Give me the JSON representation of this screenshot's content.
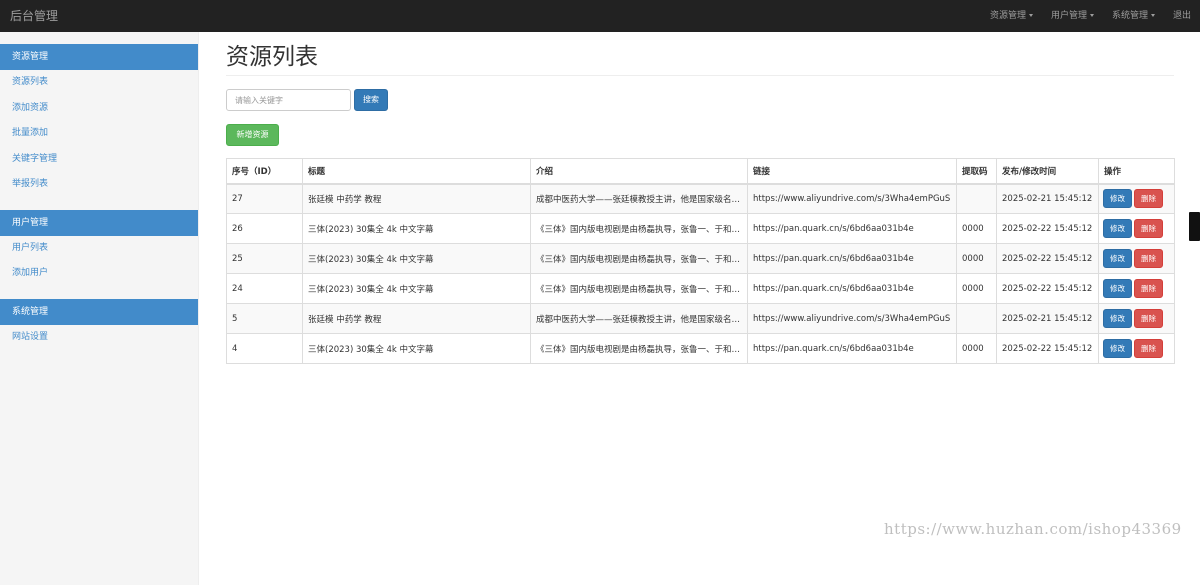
{
  "navbar": {
    "brand": "后台管理",
    "items": [
      {
        "label": "资源管理",
        "dropdown": true
      },
      {
        "label": "用户管理",
        "dropdown": true
      },
      {
        "label": "系统管理",
        "dropdown": true
      },
      {
        "label": "退出",
        "dropdown": false
      }
    ]
  },
  "sidebar": {
    "groups": [
      {
        "title": "资源管理",
        "items": [
          "资源列表",
          "添加资源",
          "批量添加",
          "关键字管理",
          "举报列表"
        ]
      },
      {
        "title": "用户管理",
        "items": [
          "用户列表",
          "添加用户"
        ]
      },
      {
        "title": "系统管理",
        "items": [
          "网站设置"
        ]
      }
    ]
  },
  "main": {
    "title": "资源列表",
    "search": {
      "placeholder": "请输入关键字",
      "button": "搜索"
    },
    "add_button": "新增资源"
  },
  "table": {
    "headers": [
      "序号（ID）",
      "标题",
      "介绍",
      "链接",
      "提取码",
      "发布/修改时间",
      "操作"
    ],
    "edit_label": "修改",
    "delete_label": "删除",
    "rows": [
      {
        "id": "27",
        "title": "张廷模 中药学 教程",
        "intro": "成都中医药大学——张廷模教授主讲，他是国家级名老中医",
        "link": "https://www.aliyundrive.com/s/3Wha4emPGuS",
        "code": "",
        "time": "2025-02-21 15:45:12"
      },
      {
        "id": "26",
        "title": "三体(2023) 30集全 4k 中文字幕",
        "intro": "《三体》国内版电视剧是由杨磊执导，张鲁一、于和伟主演",
        "link": "https://pan.quark.cn/s/6bd6aa031b4e",
        "code": "0000",
        "time": "2025-02-22 15:45:12"
      },
      {
        "id": "25",
        "title": "三体(2023) 30集全 4k 中文字幕",
        "intro": "《三体》国内版电视剧是由杨磊执导，张鲁一、于和伟主演",
        "link": "https://pan.quark.cn/s/6bd6aa031b4e",
        "code": "0000",
        "time": "2025-02-22 15:45:12"
      },
      {
        "id": "24",
        "title": "三体(2023) 30集全 4k 中文字幕",
        "intro": "《三体》国内版电视剧是由杨磊执导，张鲁一、于和伟主演",
        "link": "https://pan.quark.cn/s/6bd6aa031b4e",
        "code": "0000",
        "time": "2025-02-22 15:45:12"
      },
      {
        "id": "5",
        "title": "张廷模 中药学 教程",
        "intro": "成都中医药大学——张廷模教授主讲，他是国家级名老中医",
        "link": "https://www.aliyundrive.com/s/3Wha4emPGuS",
        "code": "",
        "time": "2025-02-21 15:45:12"
      },
      {
        "id": "4",
        "title": "三体(2023) 30集全 4k 中文字幕",
        "intro": "《三体》国内版电视剧是由杨磊执导，张鲁一、于和伟主演",
        "link": "https://pan.quark.cn/s/6bd6aa031b4e",
        "code": "0000",
        "time": "2025-02-22 15:45:12"
      }
    ]
  },
  "watermark": "https://www.huzhan.com/ishop43369",
  "colors": {
    "navbar": "#222222",
    "primary": "#428bca",
    "success": "#5cb85c",
    "danger": "#d9534f"
  }
}
